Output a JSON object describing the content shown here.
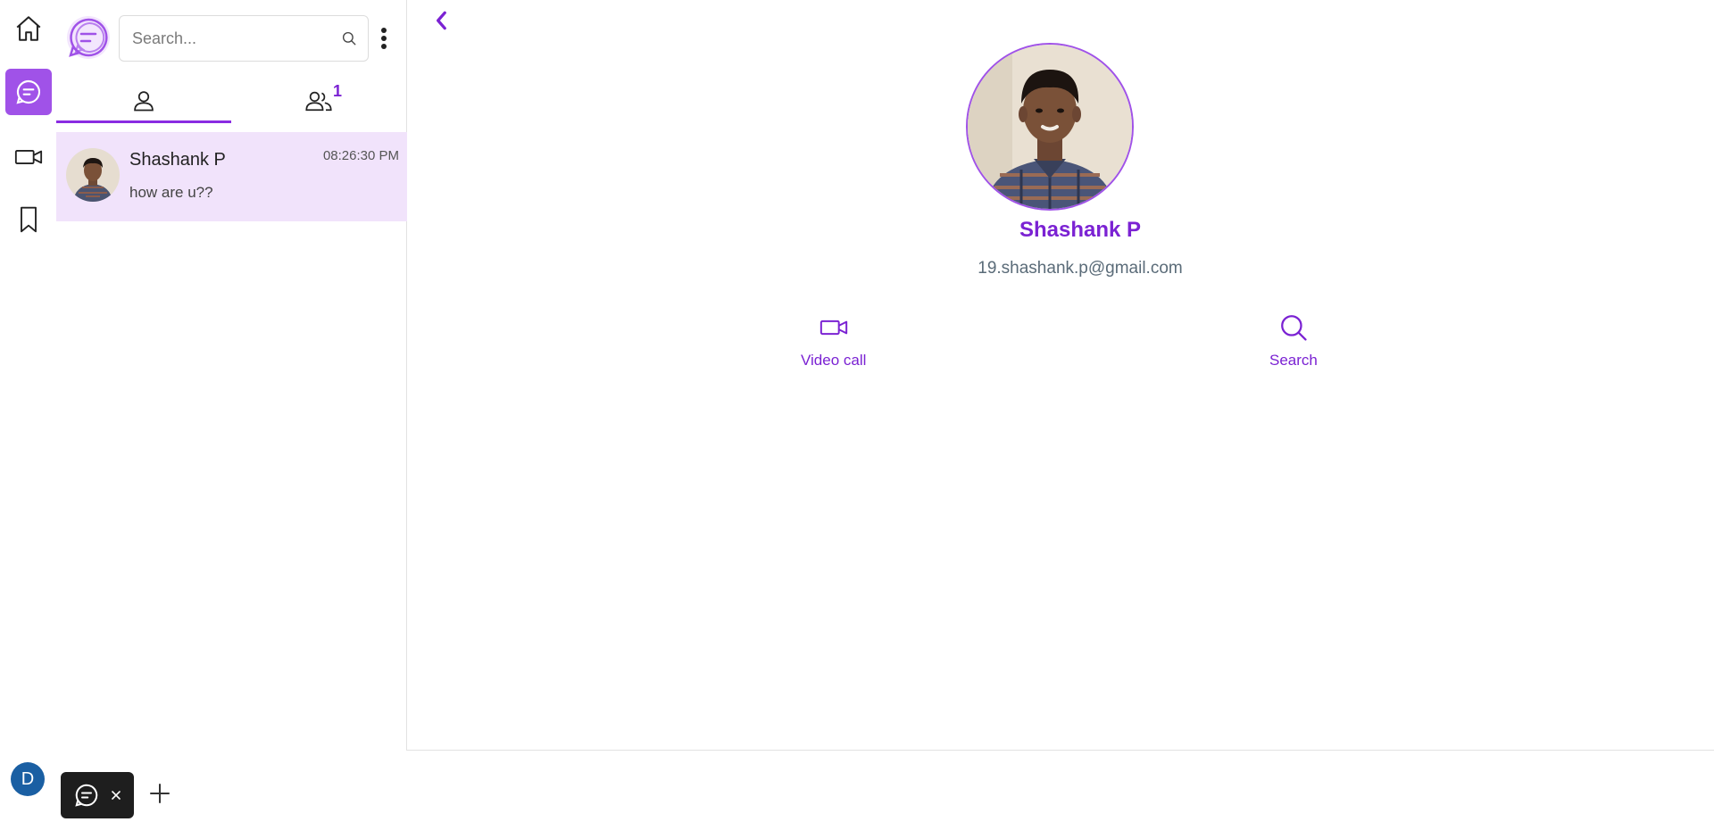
{
  "search": {
    "placeholder": "Search..."
  },
  "tabs": [
    {
      "id": "direct",
      "icon": "user-icon",
      "active": true
    },
    {
      "id": "groups",
      "icon": "users-icon",
      "badge": "1"
    }
  ],
  "chats": [
    {
      "name": "Shashank P",
      "last_message": "how are u??",
      "time": "08:26:30 PM"
    }
  ],
  "profile": {
    "name": "Shashank P",
    "email": "19.shashank.p@gmail.com",
    "actions": [
      {
        "label": "Video call",
        "icon": "video-icon"
      },
      {
        "label": "Search",
        "icon": "search-icon"
      }
    ]
  },
  "rail": {
    "items": [
      "home-icon",
      "chat-icon",
      "video-icon",
      "bookmark-icon"
    ],
    "active": "chat-icon",
    "user_initial": "D"
  },
  "colors": {
    "accent": "#8a2be2",
    "active_rail": "#a052e8",
    "selected_chat": "#f1e3fb"
  }
}
